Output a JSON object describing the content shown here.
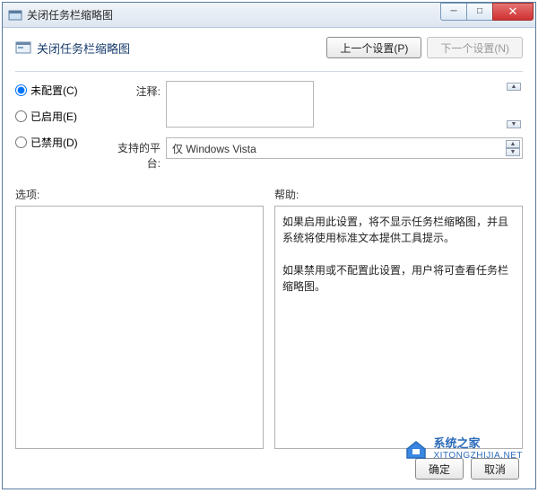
{
  "window": {
    "title": "关闭任务栏缩略图"
  },
  "header": {
    "title": "关闭任务栏缩略图",
    "prev_button": "上一个设置(P)",
    "next_button": "下一个设置(N)"
  },
  "radios": {
    "not_configured": "未配置(C)",
    "enabled": "已启用(E)",
    "disabled": "已禁用(D)",
    "selected": "not_configured"
  },
  "form": {
    "comment_label": "注释:",
    "comment_value": "",
    "platform_label": "支持的平台:",
    "platform_value": "仅 Windows Vista"
  },
  "panes": {
    "options_label": "选项:",
    "options_content": "",
    "help_label": "帮助:",
    "help_content": "如果启用此设置，将不显示任务栏缩略图，并且系统将使用标准文本提供工具提示。\n\n如果禁用或不配置此设置，用户将可查看任务栏缩略图。"
  },
  "footer": {
    "ok": "确定",
    "cancel": "取消"
  },
  "watermark": {
    "title": "系统之家",
    "url": "XITONGZHIJIA.NET"
  }
}
